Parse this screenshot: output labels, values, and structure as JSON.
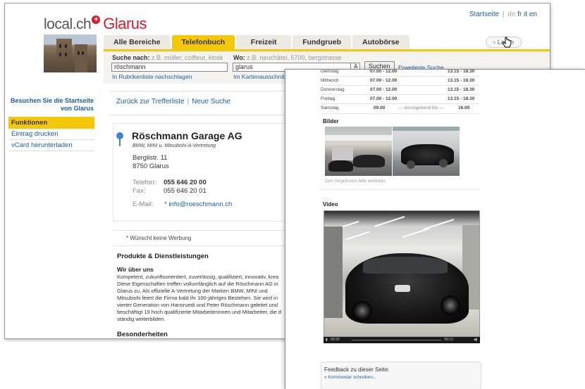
{
  "header": {
    "logo_brand": "local.ch",
    "logo_plus": "+",
    "logo_city": "Glarus",
    "top_links": {
      "home": "Startseite",
      "sep": "|",
      "langs": [
        "de",
        "fr",
        "it",
        "en"
      ]
    }
  },
  "tabs": [
    {
      "label": "Alle Bereiche"
    },
    {
      "label": "Telefonbuch",
      "active": true
    },
    {
      "label": "Freizeit"
    },
    {
      "label": "Fundgrueb"
    },
    {
      "label": "Autobörse"
    }
  ],
  "login_label": "Login",
  "search": {
    "what_label": "Suche nach:",
    "what_hint": "z.B. müller, coiffeur, kiosk",
    "what_value": "röschmann",
    "what_link": "In Rubrikenliste nachschlagen",
    "where_label": "Wo:",
    "where_hint": "z.B. neuchâtel, 5700, bergstrasse",
    "where_value": "glarus",
    "where_link": "Im Kartenausschnitt s",
    "button": "Suchen",
    "advanced": "Erweiterte Suche"
  },
  "sidebar": {
    "visit_line1": "Besuchen Sie die Startseite",
    "visit_line2": "von Glarus",
    "functions_header": "Funktionen",
    "items": [
      "Eintrag drucken",
      "vCard herunterladen"
    ]
  },
  "breadcrumb": {
    "back": "Zurück zur Trefferliste",
    "sep": "|",
    "new": "Neue Suche"
  },
  "listing": {
    "name": "Röschmann Garage AG",
    "tagline": "BMW, MINI u. Mitsubishi-A-Vertretung",
    "street": "Berglistr. 11",
    "city": "8750 Glarus",
    "phone_label": "Telefon:",
    "phone": "055 646 20 00",
    "fax_label": "Fax:",
    "fax": "055 646 20 01",
    "email_label": "E-Mail:",
    "email": "* info@roeschmann.ch",
    "no_ads": "* Wünscht keine Werbung"
  },
  "products": {
    "heading": "Produkte & Dienstleistungen",
    "subheading": "Wir über uns",
    "lines": [
      "Kompetent, zukunftsorientiert, zuverlässig, qualifiziert, innovativ, krea",
      "Diese Eigenschaften treffen vollumfänglich auf die Röschmann AG in",
      "Glarus zu. Als offizielle A-Vertretung der Marken BMW, MINI und",
      "Mitsubishi feiert die Firma bald ihr 100-jähriges Bestehen. Sie wird in",
      "vierter Generation von Hansruedi und Peter Röschmann geleitet und",
      "beschäftigt 19 hoch qualifizierte Mitarbeiterinnen und Mitarbeiter, die d",
      "ständig weiterbilden."
    ],
    "special_heading": "Besonderheiten"
  },
  "hours": [
    {
      "day": "Dienstag",
      "am": "07.00 - 12.00",
      "pm": "13.15 - 18.30"
    },
    {
      "day": "Mittwoch",
      "am": "07.00 - 12.00",
      "pm": "13.15 - 18.30"
    },
    {
      "day": "Donnerstag",
      "am": "07.00 - 12.00",
      "pm": "13.15 - 18.30"
    },
    {
      "day": "Freitag",
      "am": "07.00 - 12.00",
      "pm": "13.15 - 18.30"
    },
    {
      "day": "Samstag",
      "am": "09.00",
      "mid": "--- durchgehend bis ---",
      "pm": "16.00"
    }
  ],
  "images": {
    "heading": "Bilder",
    "caption": "Zum Vergrössern bitte anklicken"
  },
  "video": {
    "heading": "Video",
    "time_current": "00:20",
    "time_total": "00:12"
  },
  "feedback": {
    "title": "Feedback zu dieser Seite:",
    "link": "» Kommentar schreiben..."
  },
  "colors": {
    "brand_red": "#d81b2b",
    "accent_yellow": "#f3c80a",
    "link_blue": "#1b5fa8"
  }
}
